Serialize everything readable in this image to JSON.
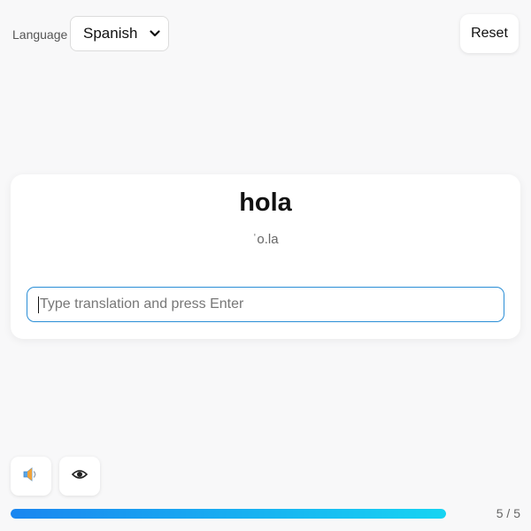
{
  "header": {
    "language_label": "Language",
    "language_selected": "Spanish",
    "reset_label": "Reset"
  },
  "card": {
    "word": "hola",
    "pronunciation": "ˈo.la",
    "input_value": "",
    "input_placeholder": "Type translation and press Enter"
  },
  "controls": {
    "speaker_icon": "speaker-icon",
    "eye_icon": "eye-icon"
  },
  "progress": {
    "current": 5,
    "total": 5,
    "fraction": 1.0,
    "label": "5 / 5"
  },
  "colors": {
    "input_border": "#2a8ed6",
    "progress_start": "#1a86f0",
    "progress_end": "#17d4f2"
  }
}
